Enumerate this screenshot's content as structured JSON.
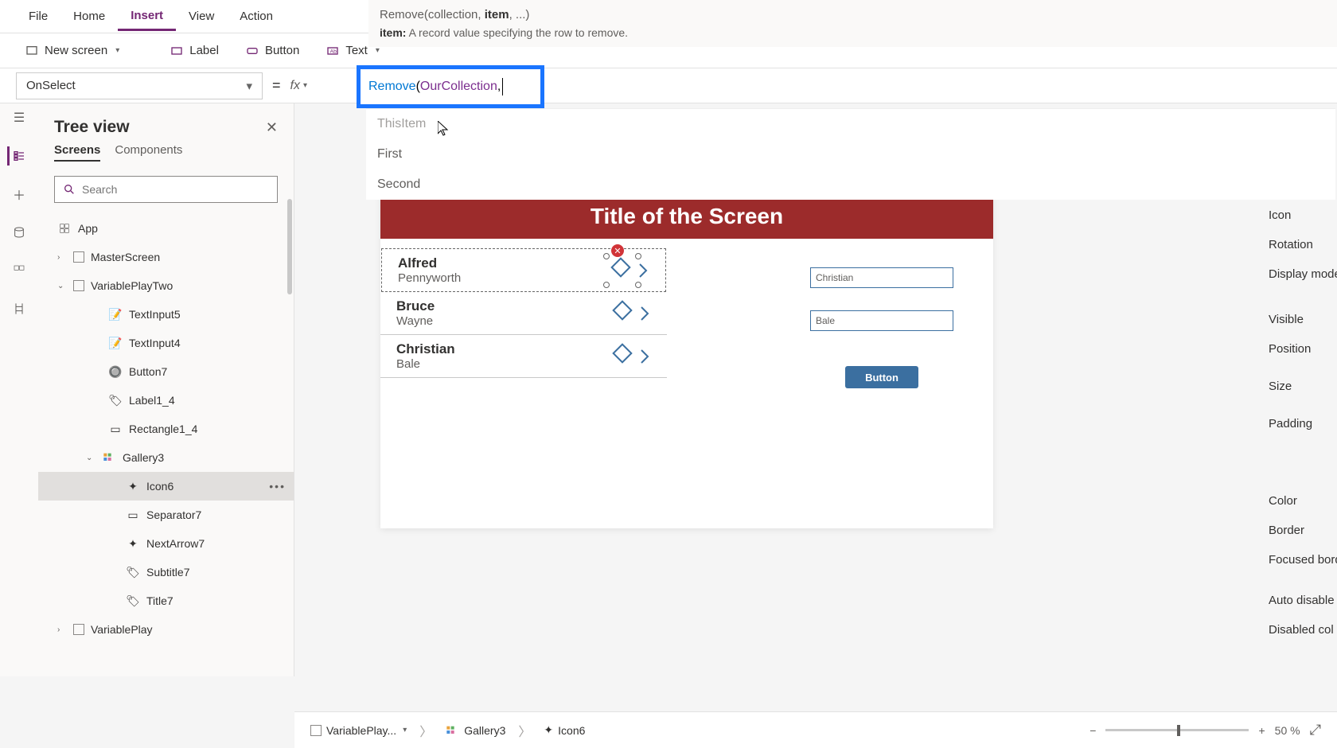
{
  "menu": {
    "file": "File",
    "home": "Home",
    "insert": "Insert",
    "view": "View",
    "action": "Action"
  },
  "ribbon": {
    "new_screen": "New screen",
    "label": "Label",
    "button": "Button",
    "text": "Text"
  },
  "property_selector": "OnSelect",
  "signature": {
    "full": "Remove(collection, item, ...)",
    "fn": "Remove",
    "cur": "item",
    "param_name": "item:",
    "param_desc": "A record value specifying the row to remove."
  },
  "formula": {
    "fn": "Remove",
    "open": "(",
    "arg": "OurCollection",
    "comma": ", "
  },
  "autocomplete": [
    "ThisItem",
    "First",
    "Second"
  ],
  "tree": {
    "title": "Tree view",
    "tabs": {
      "screens": "Screens",
      "components": "Components"
    },
    "search_placeholder": "Search",
    "app": "App",
    "nodes": {
      "master": "MasterScreen",
      "varplaytwo": "VariablePlayTwo",
      "textinput5": "TextInput5",
      "textinput4": "TextInput4",
      "button7": "Button7",
      "label14": "Label1_4",
      "rect14": "Rectangle1_4",
      "gallery3": "Gallery3",
      "icon6": "Icon6",
      "separator7": "Separator7",
      "nextarrow7": "NextArrow7",
      "subtitle7": "Subtitle7",
      "title7": "Title7",
      "varplay": "VariablePlay"
    }
  },
  "canvas": {
    "title": "Title of the Screen",
    "rows": [
      {
        "first": "Alfred",
        "last": "Pennyworth"
      },
      {
        "first": "Bruce",
        "last": "Wayne"
      },
      {
        "first": "Christian",
        "last": "Bale"
      }
    ],
    "input1": "Christian",
    "input2": "Bale",
    "button": "Button"
  },
  "props": [
    "Icon",
    "Rotation",
    "Display mode",
    "Visible",
    "Position",
    "Size",
    "Padding",
    "Color",
    "Border",
    "Focused border",
    "Auto disable",
    "Disabled col"
  ],
  "breadcrumb": {
    "screen": "VariablePlay...",
    "gallery": "Gallery3",
    "icon": "Icon6"
  },
  "zoom": {
    "percent": "50",
    "pct_label": "%",
    "minus": "−",
    "plus": "+"
  }
}
